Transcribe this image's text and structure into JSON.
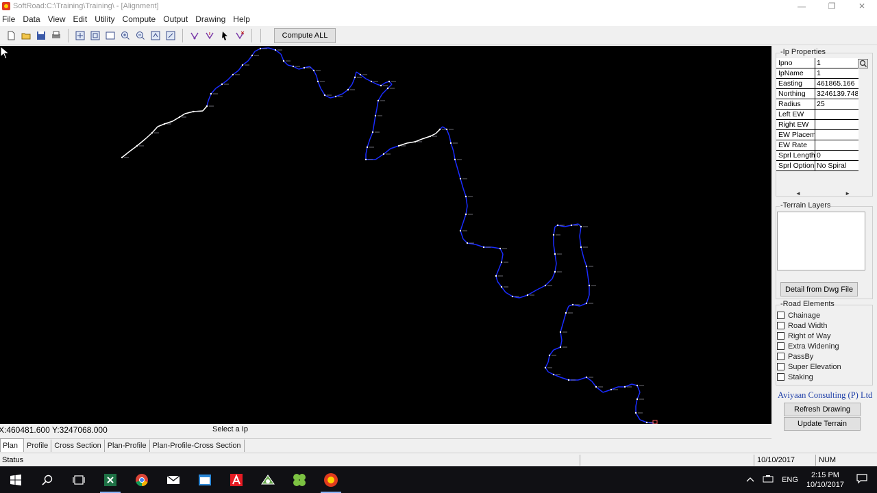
{
  "window": {
    "title": "SoftRoad:C:\\Training\\Training\\ - [Alignment]",
    "min_glyph": "—",
    "restore_glyph": "❐",
    "close_glyph": "✕"
  },
  "menu": [
    "File",
    "Data",
    "View",
    "Edit",
    "Utility",
    "Compute",
    "Output",
    "Drawing",
    "Help"
  ],
  "toolbar": {
    "compute_all_label": "Compute ALL"
  },
  "ip_properties": {
    "group_label": "-Ip Properties",
    "rows": [
      {
        "key": "Ipno",
        "value": "1"
      },
      {
        "key": "IpName",
        "value": "1"
      },
      {
        "key": "Easting",
        "value": "461865.166"
      },
      {
        "key": "Northing",
        "value": "3246139.748"
      },
      {
        "key": "Radius",
        "value": "25"
      },
      {
        "key": "Left EW",
        "value": ""
      },
      {
        "key": "Right EW",
        "value": ""
      },
      {
        "key": "EW Placement",
        "value": ""
      },
      {
        "key": "EW Rate",
        "value": ""
      },
      {
        "key": "Sprl Length",
        "value": "0"
      },
      {
        "key": "Sprl Option",
        "value": "No Spiral"
      }
    ],
    "scroll_left": "◄",
    "scroll_right": "►"
  },
  "terrain_layers": {
    "group_label": "-Terrain Layers",
    "detail_button": "Detail from Dwg File"
  },
  "road_elements": {
    "group_label": "-Road Elements",
    "items": [
      "Chainage",
      "Road Width",
      "Right of Way",
      "Extra Widening",
      "PassBy",
      "Super Elevation",
      "Staking"
    ]
  },
  "company": "Aviyaan Consulting (P) Ltd",
  "buttons": {
    "refresh": "Refresh Drawing",
    "update_terrain": "Update Terrain"
  },
  "coords": {
    "x": "X:460481.600",
    "y": "Y:3247068.000",
    "message": "Select a Ip"
  },
  "tabs": [
    "Plan",
    "Profile",
    "Cross Section",
    "Plan-Profile",
    "Plan-Profile-Cross Section"
  ],
  "statusbar": {
    "status": "Status",
    "date": "10/10/2017",
    "num": "NUM"
  },
  "taskbar": {
    "lang": "ENG",
    "time": "2:15 PM",
    "date": "10/10/2017"
  },
  "colors": {
    "canvas_bg": "#000000",
    "alignment_line": "#1a2cff",
    "alignment_white": "#ffffff",
    "company_text": "#1f3fa8"
  }
}
